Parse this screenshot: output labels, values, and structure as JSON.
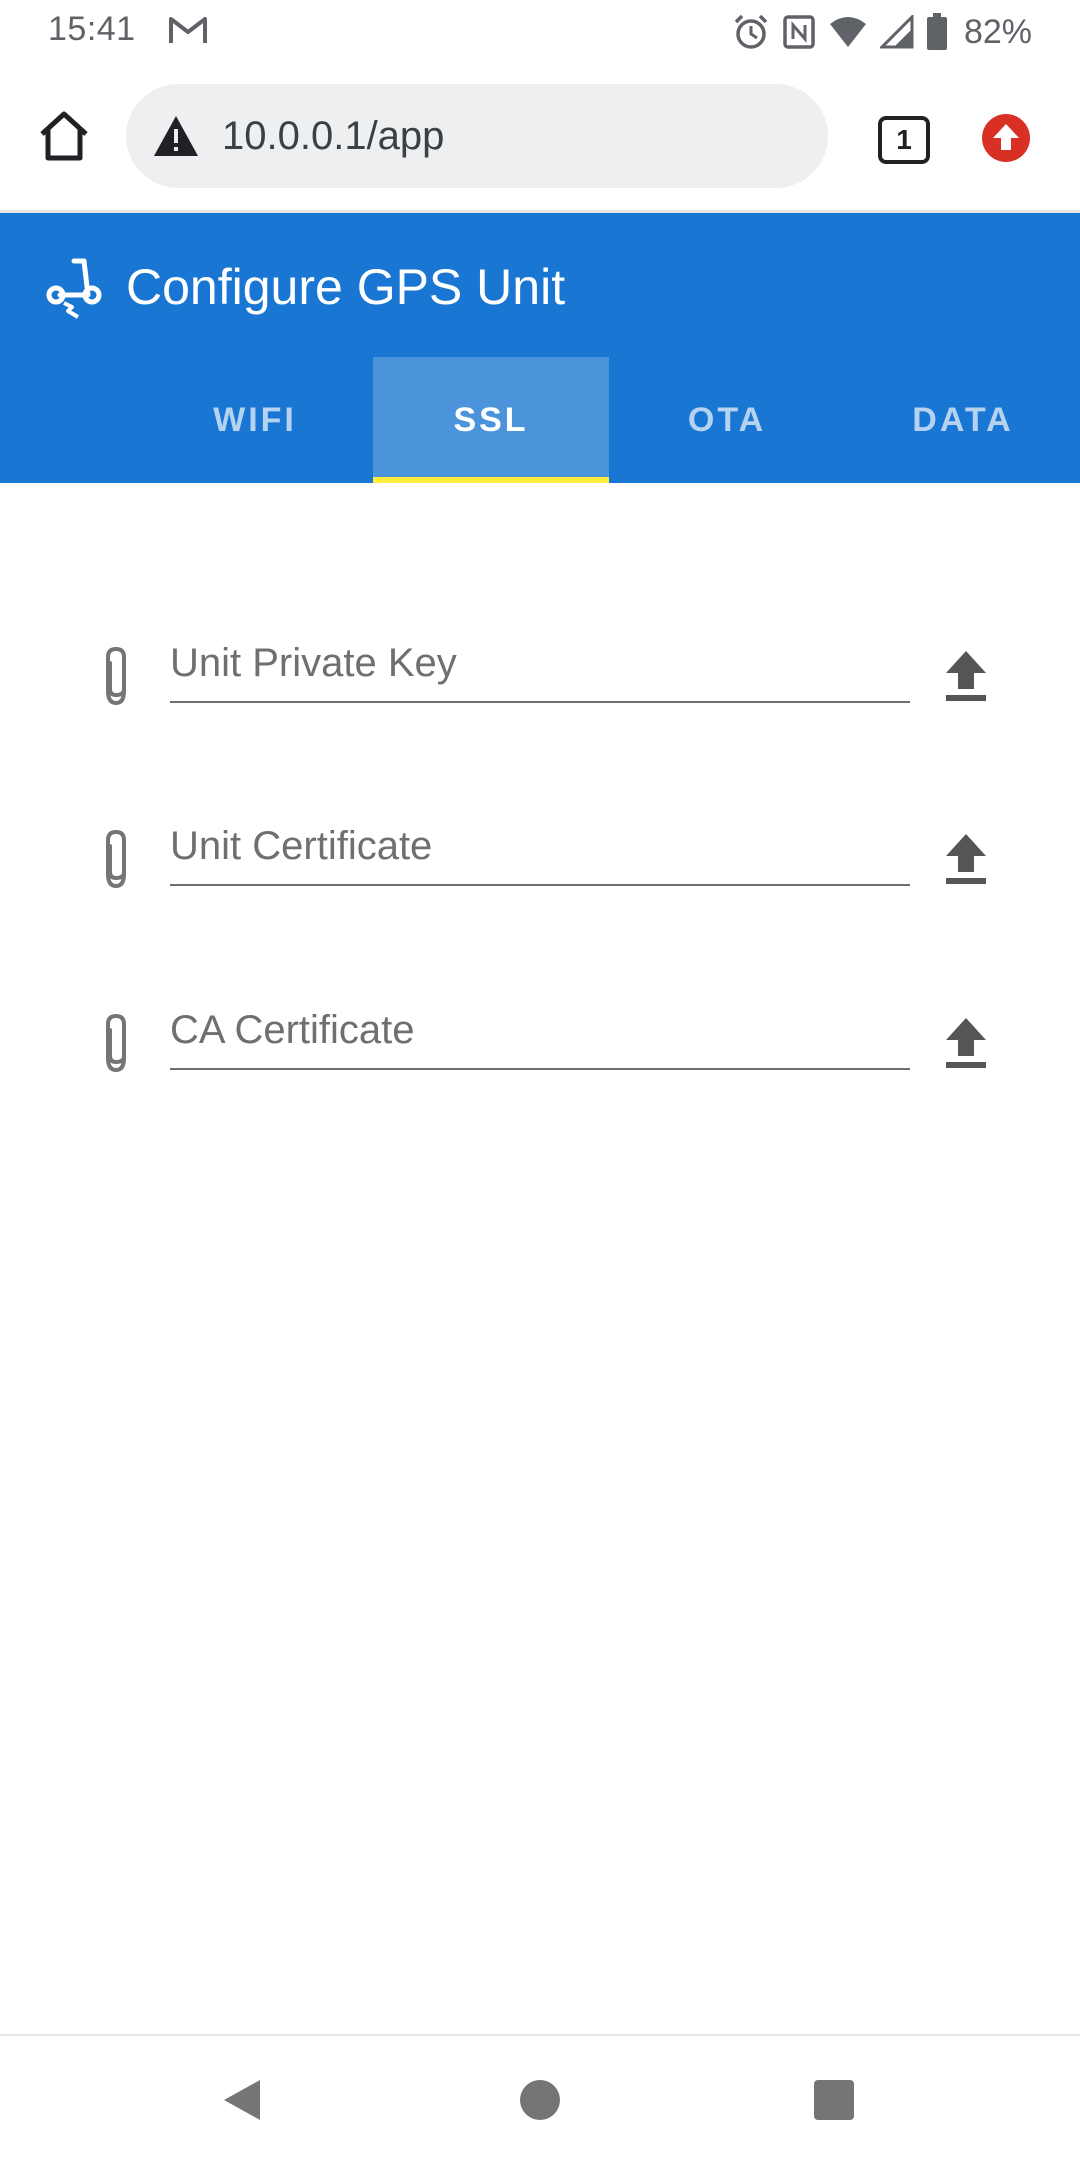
{
  "status_bar": {
    "time": "15:41",
    "battery_percent": "82%",
    "icons": [
      "gmail-icon",
      "alarm-icon",
      "nfc-icon",
      "wifi-icon",
      "signal-icon",
      "battery-icon"
    ]
  },
  "browser": {
    "url": "10.0.0.1/app",
    "tab_count": "1",
    "icons": [
      "home-icon",
      "not-secure-warning-icon",
      "tab-switcher-icon",
      "update-available-icon"
    ]
  },
  "app": {
    "title": "Configure GPS Unit",
    "logo_icon": "scooter-icon",
    "accent_color": "#1976d2",
    "indicator_color": "#ffeb3b",
    "tabs": [
      {
        "label": "WIFI",
        "active": false
      },
      {
        "label": "SSL",
        "active": true
      },
      {
        "label": "OTA",
        "active": false
      },
      {
        "label": "DATA",
        "active": false
      }
    ]
  },
  "ssl_form": {
    "fields": [
      {
        "placeholder": "Unit Private Key",
        "icon": "paperclip-icon",
        "action_icon": "upload-icon"
      },
      {
        "placeholder": "Unit Certificate",
        "icon": "paperclip-icon",
        "action_icon": "upload-icon"
      },
      {
        "placeholder": "CA Certificate",
        "icon": "paperclip-icon",
        "action_icon": "upload-icon"
      }
    ]
  },
  "nav_bar": {
    "icons": [
      "back-icon",
      "home-circle-icon",
      "recents-icon"
    ]
  }
}
